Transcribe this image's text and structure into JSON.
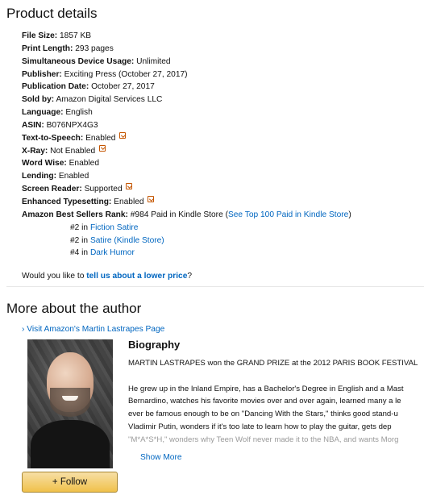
{
  "product_details": {
    "title": "Product details",
    "file_size": {
      "label": "File Size:",
      "value": "1857 KB"
    },
    "print_length": {
      "label": "Print Length:",
      "value": "293 pages"
    },
    "device_usage": {
      "label": "Simultaneous Device Usage:",
      "value": "Unlimited"
    },
    "publisher": {
      "label": "Publisher:",
      "value": "Exciting Press (October 27, 2017)"
    },
    "publication_date": {
      "label": "Publication Date:",
      "value": "October 27, 2017"
    },
    "sold_by": {
      "label": "Sold by:",
      "value": "Amazon Digital Services LLC"
    },
    "language": {
      "label": "Language:",
      "value": "English"
    },
    "asin": {
      "label": "ASIN:",
      "value": "B076NPX4G3"
    },
    "text_to_speech": {
      "label": "Text-to-Speech:",
      "value": "Enabled"
    },
    "xray": {
      "label": "X-Ray:",
      "value": "Not Enabled"
    },
    "word_wise": {
      "label": "Word Wise:",
      "value": "Enabled"
    },
    "lending": {
      "label": "Lending:",
      "value": "Enabled"
    },
    "screen_reader": {
      "label": "Screen Reader:",
      "value": "Supported"
    },
    "enhanced_typesetting": {
      "label": "Enhanced Typesetting:",
      "value": "Enabled"
    },
    "best_sellers": {
      "label": "Amazon Best Sellers Rank:",
      "value": "#984 Paid in Kindle Store (",
      "link": "See Top 100 Paid in Kindle Store",
      "close": ")",
      "sub_ranks": [
        {
          "rank": "#2 in",
          "category": "Fiction Satire",
          "extra": ""
        },
        {
          "rank": "#2 in",
          "category": "Satire",
          "extra": "(Kindle Store)"
        },
        {
          "rank": "#4 in",
          "category": "Dark Humor",
          "extra": ""
        }
      ]
    },
    "lower_price": {
      "prefix": "Would you like to",
      "link": "tell us about a lower price",
      "suffix": "?"
    }
  },
  "author": {
    "title": "More about the author",
    "visit_link": "› Visit Amazon's Martin Lastrapes Page",
    "bio_title": "Biography",
    "bio_lines": [
      "MARTIN LASTRAPES won the GRAND PRIZE at the 2012 PARIS BOOK FESTIVAL",
      "",
      "He grew up in the Inland Empire, has a Bachelor's Degree in English and a Mast",
      "Bernardino, watches his favorite movies over and over again, learned many a le",
      "ever be famous enough to be on \"Dancing With the Stars,\" thinks good stand-u",
      "Vladimir Putin, wonders if it's too late to learn how to play the guitar, gets dep",
      "\"M*A*S*H,\" wonders why Teen Wolf never made it to the NBA, and wants Morg"
    ],
    "show_more": "Show More",
    "follow_label": "+ Follow"
  }
}
